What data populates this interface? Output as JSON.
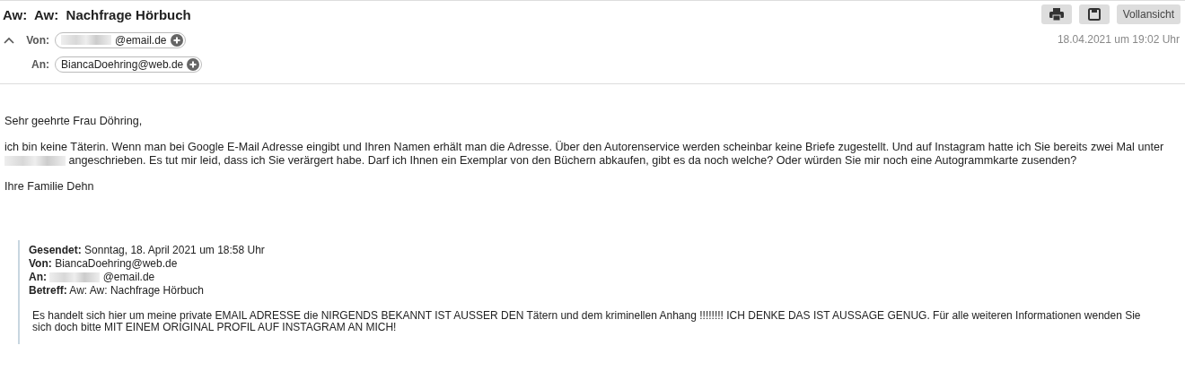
{
  "subject": "Aw:  Aw:  Nachfrage Hörbuch",
  "toolbar": [
    {
      "kind": "print"
    },
    {
      "kind": "save"
    },
    {
      "kind": "text",
      "label": "Vollansicht"
    }
  ],
  "header": {
    "expanded": true,
    "from": {
      "label": "Von:",
      "redacted": true,
      "address": "@email.de"
    },
    "to": {
      "label": "An:",
      "redacted": false,
      "address": "BiancaDoehring@web.de"
    },
    "date": "18.04.2021 um 19:02 Uhr"
  },
  "body": [
    [
      {
        "text": "Sehr geehrte Frau Döhring,"
      }
    ],
    [
      {
        "text": "ich bin keine Täterin. Wenn man bei Google E-Mail Adresse eingibt und Ihren Namen erhält man die Adresse. Über den Autorenservice werden scheinbar keine Briefe zugestellt. Und auf Instagram hatte ich Sie bereits zwei Mal unter "
      },
      {
        "kind": "redaction"
      },
      {
        "text": " angeschrieben. Es tut mir leid, dass ich Sie verärgert habe. Darf ich Ihnen ein Exemplar von den Büchern abkaufen, gibt es da noch welche? Oder würden Sie mir noch eine Autogrammkarte zusenden?"
      }
    ],
    [
      {
        "text": "Ihre Familie Dehn"
      }
    ]
  ],
  "quote": {
    "fields": [
      {
        "label": "Gesendet:",
        "value": "Sonntag, 18. April 2021 um 18:58 Uhr",
        "redacted": false
      },
      {
        "label": "Von:",
        "value": "BiancaDoehring@web.de",
        "redacted": false
      },
      {
        "label": "An:",
        "value": "@email.de",
        "redacted": true
      },
      {
        "label": "Betreff:",
        "value": "Aw: Aw:  Nachfrage Hörbuch",
        "redacted": false
      }
    ],
    "text": "Es handelt sich hier um meine private EMAIL ADRESSE die NIRGENDS BEKANNT IST AUSSER DEN Tätern und dem kriminellen Anhang !!!!!!!! ICH DENKE DAS IST AUSSAGE GENUG. Für alle weiteren Informationen wenden Sie sich doch bitte MIT EINEM ORIGINAL PROFIL AUF INSTAGRAM AN MICH!"
  }
}
